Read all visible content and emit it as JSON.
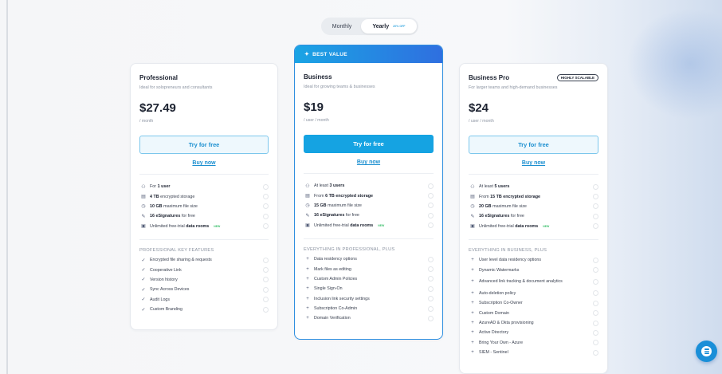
{
  "billing_toggle": {
    "monthly": "Monthly",
    "yearly": "Yearly",
    "yearly_discount": "20% OFF"
  },
  "plans": [
    {
      "name": "Professional",
      "description": "Ideal for solopreneurs and consultants",
      "price": "$27.49",
      "period": "/ month",
      "cta_primary": "Try for free",
      "cta_secondary": "Buy now",
      "features": [
        {
          "icon": "user-icon",
          "prefix": "For ",
          "bold": "1 user",
          "suffix": ""
        },
        {
          "icon": "storage-icon",
          "prefix": "",
          "bold": "4 TB",
          "suffix": " encrypted storage"
        },
        {
          "icon": "file-size-icon",
          "prefix": "",
          "bold": "10 GB",
          "suffix": " maximum file size"
        },
        {
          "icon": "signature-icon",
          "prefix": "",
          "bold": "16 eSignatures",
          "suffix": " for free"
        },
        {
          "icon": "data-room-icon",
          "prefix": "Unlimited free-trial ",
          "bold": "data rooms",
          "suffix": "",
          "tag": "NEW"
        }
      ],
      "section_title": "PROFESSIONAL KEY FEATURES",
      "list": [
        "Encrypted file sharing & requests",
        "Cooperative Link",
        "Version history",
        "Sync Across Devices",
        "Audit Logs",
        "Custom Branding"
      ]
    },
    {
      "name": "Business",
      "banner": "BEST VALUE",
      "description": "Ideal for growing teams & businesses",
      "price": "$19",
      "period": "/ user / month",
      "cta_primary": "Try for free",
      "cta_secondary": "Buy now",
      "features": [
        {
          "icon": "users-icon",
          "prefix": "At least ",
          "bold": "3 users",
          "suffix": ""
        },
        {
          "icon": "storage-icon",
          "prefix": "From ",
          "bold": "6 TB encrypted storage",
          "suffix": ""
        },
        {
          "icon": "file-size-icon",
          "prefix": "",
          "bold": "15 GB",
          "suffix": " maximum file size"
        },
        {
          "icon": "signature-icon",
          "prefix": "",
          "bold": "16 eSignatures",
          "suffix": " for free"
        },
        {
          "icon": "data-room-icon",
          "prefix": "Unlimited free-trial ",
          "bold": "data rooms",
          "suffix": "",
          "tag": "NEW"
        }
      ],
      "section_title": "EVERYTHING IN PROFESSIONAL, PLUS",
      "list": [
        "Data residency options",
        "Mark files as editing",
        "Custom Admin Policies",
        "Single Sign-On",
        "Inclusion link security settings",
        "Subscription Co-Admin",
        "Domain Verification"
      ]
    },
    {
      "name": "Business Pro",
      "badge": "HIGHLY SCALABLE",
      "description": "For larger teams and high-demand businesses",
      "price": "$24",
      "period": "/ user / month",
      "cta_primary": "Try for free",
      "cta_secondary": "Buy now",
      "features": [
        {
          "icon": "users-icon",
          "prefix": "At least ",
          "bold": "5 users",
          "suffix": ""
        },
        {
          "icon": "storage-icon",
          "prefix": "From ",
          "bold": "15 TB encrypted storage",
          "suffix": ""
        },
        {
          "icon": "file-size-icon",
          "prefix": "",
          "bold": "20 GB",
          "suffix": " maximum file size"
        },
        {
          "icon": "signature-icon",
          "prefix": "",
          "bold": "16 eSignatures",
          "suffix": " for free"
        },
        {
          "icon": "data-room-icon",
          "prefix": "Unlimited free-trial ",
          "bold": "data rooms",
          "suffix": "",
          "tag": "NEW"
        }
      ],
      "section_title": "EVERYTHING IN BUSINESS, PLUS",
      "list": [
        "User level data residency options",
        "Dynamic Watermarks",
        "Advanced link tracking & document analytics",
        "Auto-deletion policy",
        "Subscription Co-Owner",
        "Custom Domain",
        "AzureAD & Okta provisioning",
        "Active Directory",
        "Bring Your Own - Azure",
        "SIEM - Sentinel"
      ]
    }
  ],
  "colors": {
    "accent": "#15a3e2",
    "link": "#1b8fd0",
    "new_tag": "#3cbf6c",
    "chat": "#1a8fd8"
  }
}
